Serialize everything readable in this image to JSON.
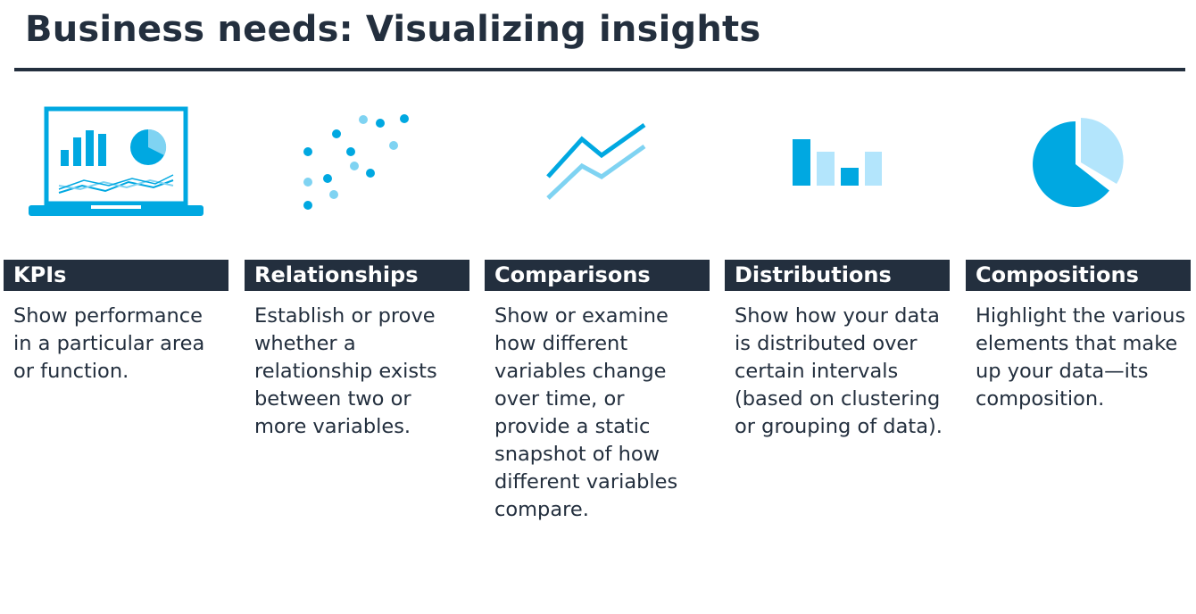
{
  "title": "Business needs: Visualizing insights",
  "colors": {
    "navy": "#232f3e",
    "blue": "#00a8e1",
    "light_blue": "#7fd3f2",
    "pale_blue": "#b3e5fc"
  },
  "categories": [
    {
      "heading": "KPIs",
      "icon": "laptop-dashboard-icon",
      "description": "Show performance in a particular area or function."
    },
    {
      "heading": "Relationships",
      "icon": "scatter-plot-icon",
      "description": "Establish or prove whether a relationship exists between two or more variables."
    },
    {
      "heading": "Comparisons",
      "icon": "line-chart-icon",
      "description": "Show or examine how different variables change over time, or provide a static snapshot of how different variables compare."
    },
    {
      "heading": "Distributions",
      "icon": "bar-chart-icon",
      "description": "Show how your data is distributed over certain intervals (based on clustering or grouping of data)."
    },
    {
      "heading": "Compositions",
      "icon": "pie-chart-icon",
      "description": "Highlight the various elements that make up your data—its composition."
    }
  ]
}
